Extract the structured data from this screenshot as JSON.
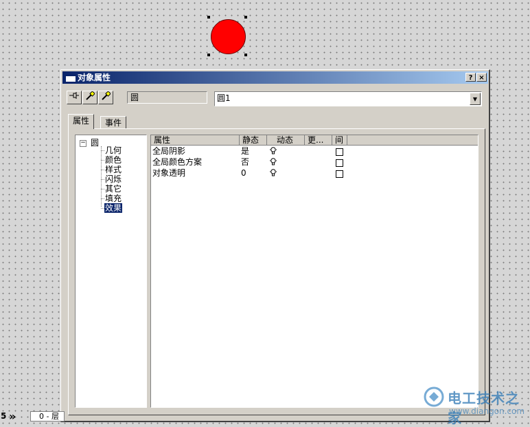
{
  "dialog": {
    "title": "对象属性",
    "help_btn": "?",
    "close_btn": "×",
    "object_name": "圆",
    "object_combo_value": "圆1",
    "toolbar": [
      "pin-icon",
      "pipette-icon",
      "pipette-icon"
    ]
  },
  "tabs": [
    {
      "label": "属性",
      "active": true
    },
    {
      "label": "事件",
      "active": false
    }
  ],
  "tree": {
    "expander": "−",
    "root": "圆",
    "items": [
      "几何",
      "颜色",
      "样式",
      "闪烁",
      "其它",
      "填充",
      "效果"
    ],
    "selected": "效果"
  },
  "grid": {
    "headers": [
      "属性",
      "静态",
      "动态",
      "更...",
      "间"
    ],
    "rows": [
      {
        "name": "全局阴影",
        "static": "是"
      },
      {
        "name": "全局颜色方案",
        "static": "否"
      },
      {
        "name": "对象透明",
        "static": "0"
      }
    ]
  },
  "taskbar": {
    "page_num": "5",
    "nav": "»",
    "page_field": "0 - 层"
  },
  "watermark": {
    "text": "电工技术之家",
    "url": "www.diangon.com"
  },
  "colors": {
    "circle": "#ff0000",
    "titlebar": "#0a246a",
    "selection": "#0a246a"
  }
}
